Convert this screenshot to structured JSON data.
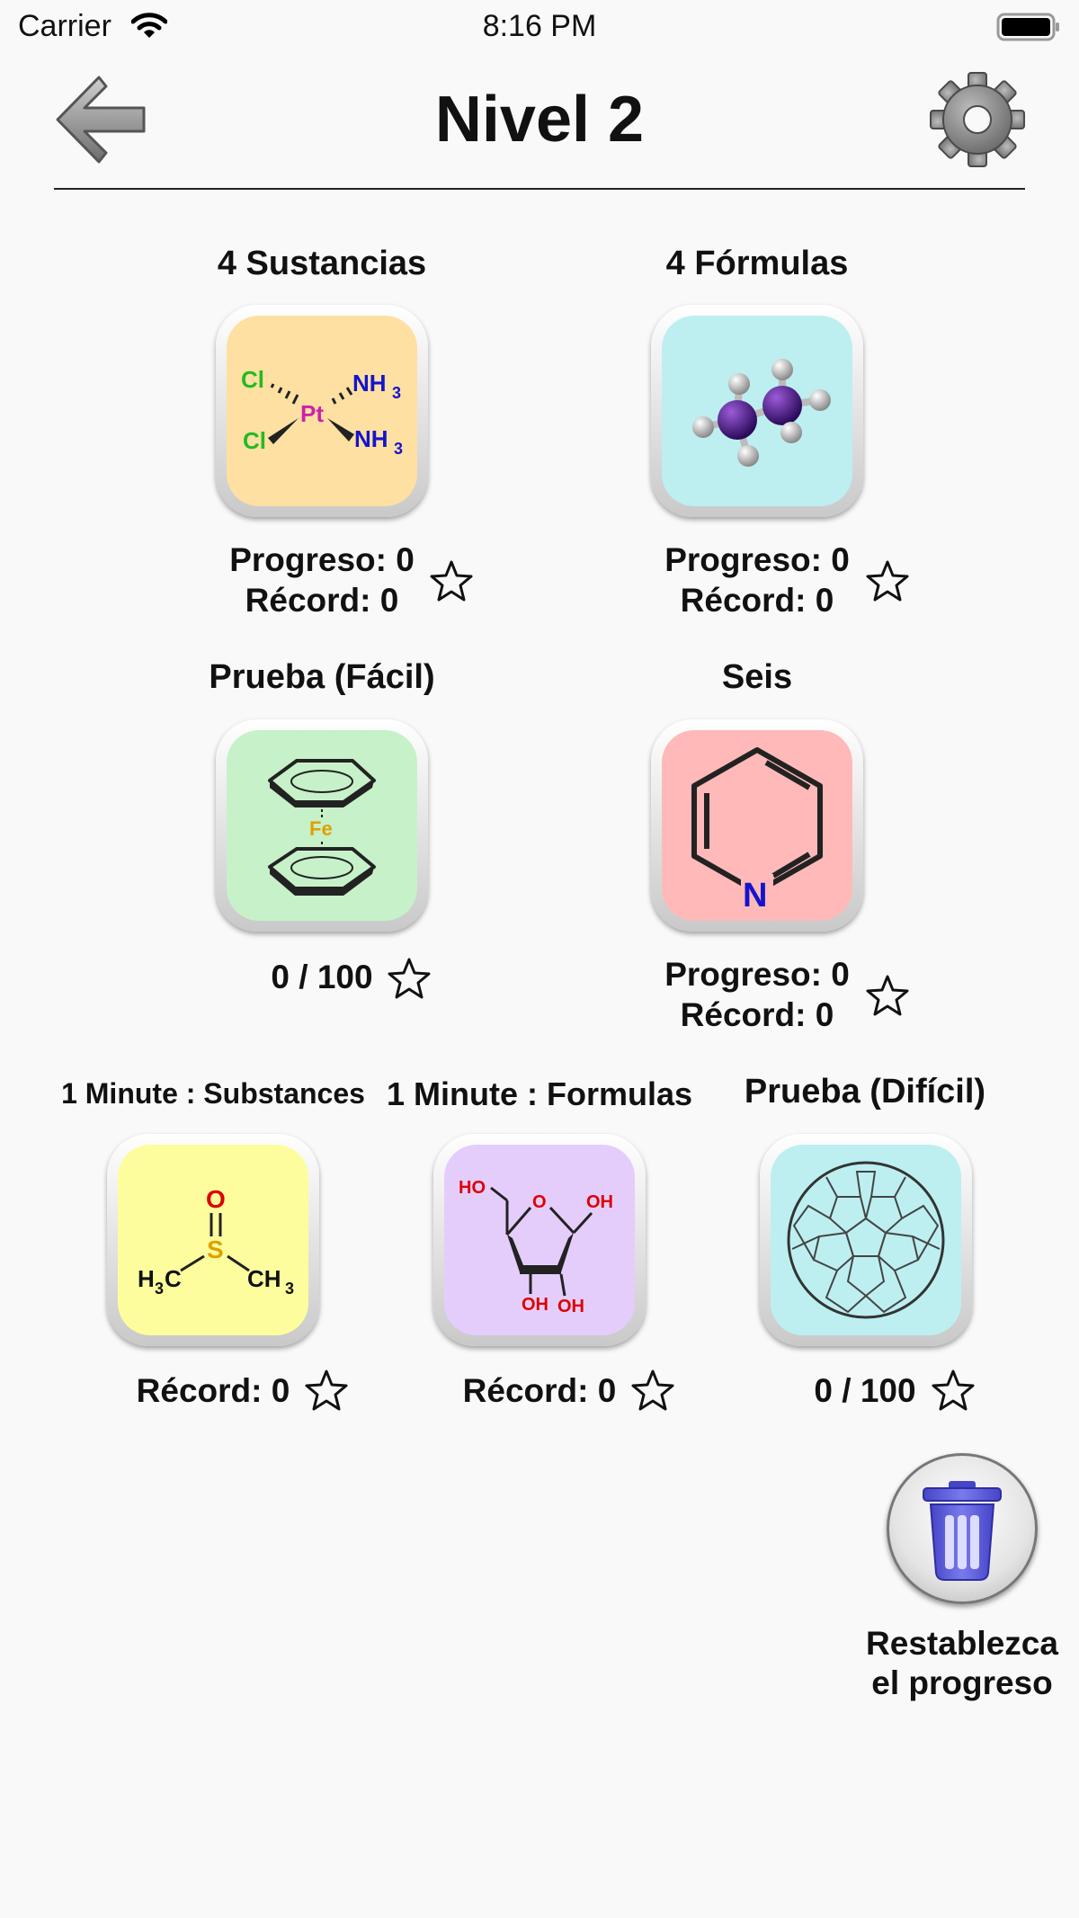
{
  "status_bar": {
    "carrier": "Carrier",
    "time": "8:16 PM"
  },
  "header": {
    "title": "Nivel 2"
  },
  "tiles": [
    {
      "title": "4 Sustancias",
      "progress": "Progreso: 0",
      "record": "Récord: 0",
      "bg": "#fde0a2",
      "icon": "cisplatin-icon",
      "labels": {
        "cl1": "Cl",
        "cl2": "Cl",
        "pt": "Pt",
        "nh1": "NH",
        "nh2": "NH",
        "sub": "3"
      }
    },
    {
      "title": "4 Fórmulas",
      "progress": "Progreso: 0",
      "record": "Récord: 0",
      "bg": "#bdeff0",
      "icon": "molecule-3d-icon"
    },
    {
      "title": "Prueba (Fácil)",
      "score": "0 / 100",
      "bg": "#c7f1c8",
      "icon": "ferrocene-icon",
      "labels": {
        "fe": "Fe"
      }
    },
    {
      "title": "Seis",
      "progress": "Progreso: 0",
      "record": "Récord: 0",
      "bg": "#ffb9b9",
      "icon": "pyridine-icon",
      "labels": {
        "n": "N"
      }
    },
    {
      "title": "1 Minute : Substances",
      "record": "Récord: 0",
      "bg": "#fdfd9e",
      "icon": "dmso-icon",
      "labels": {
        "o": "O",
        "s": "S",
        "h3c": "H",
        "ch3": "CH",
        "sub": "3"
      }
    },
    {
      "title": "1 Minute : Formulas",
      "record": "Récord: 0",
      "bg": "#e5cdfb",
      "icon": "ribose-icon",
      "labels": {
        "ho": "HO",
        "o": "O",
        "oh1": "OH",
        "oh2": "OH",
        "oh3": "OH"
      }
    },
    {
      "title": "Prueba (Difícil)",
      "score": "0 / 100",
      "bg": "#bdeff0",
      "icon": "fullerene-icon"
    }
  ],
  "reset": {
    "line1": "Restablezca",
    "line2": "el progreso"
  },
  "colors": {
    "star_outline": "#111111",
    "trash_blue": "#5f5fe0",
    "chlorine_green": "#22bb22",
    "nitrogen_blue": "#1414cc",
    "platinum_magenta": "#cc22aa",
    "oxygen_red": "#dd0000",
    "sulfur_gold": "#e0a000"
  }
}
